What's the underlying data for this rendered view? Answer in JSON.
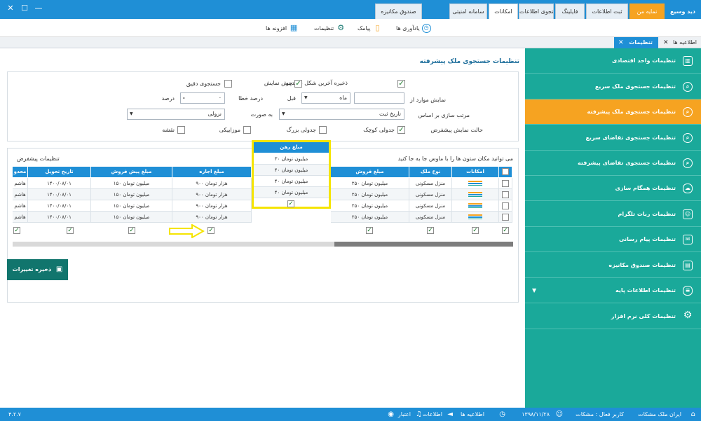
{
  "window": {
    "minimize": "—",
    "maximize": "☐",
    "close": "✕"
  },
  "top_tabs": [
    {
      "label": "دید وسیع",
      "style": "plain"
    },
    {
      "label": "نمایه من",
      "style": "orange"
    },
    {
      "label": "ثبت اطلاعات",
      "style": "normal"
    },
    {
      "label": "فایلینگ",
      "style": "normal"
    },
    {
      "label": "جستجوی اطلاعات",
      "style": "normal"
    },
    {
      "label": "امکانات",
      "style": "active"
    },
    {
      "label": "سامانه امنیتی",
      "style": "normal"
    },
    {
      "label": "صندوق مکانیزه",
      "style": "normal"
    }
  ],
  "ribbon": [
    {
      "label": "یادآوری ها",
      "icon": "clock-icon"
    },
    {
      "label": "پیامک",
      "icon": "sms-icon"
    },
    {
      "label": "تنظیمات",
      "icon": "gear-icon"
    },
    {
      "label": "افزونه ها",
      "icon": "puzzle-icon"
    }
  ],
  "doc_tabs": [
    {
      "label": "تنظیمات",
      "active": true
    },
    {
      "label": "اطلاعیه ها",
      "active": false
    }
  ],
  "page_title": "تنظیمات جستجوی ملک پیشرفته",
  "options": {
    "save_last_search": "ذخیره آخرین شکل جستجو",
    "preview": "پیش نمایش",
    "exact_search": "جستجوی دقیق",
    "show_items_from": "نمایش موارد از",
    "month_value": "ماه",
    "before": "قبل",
    "error_percent": "درصد خطا",
    "error_value": "۰",
    "percent": "درصد",
    "sort_by": "مرتب سازی بر اساس",
    "sort_value": "تاریخ ثبت",
    "as": "به صورت",
    "order_value": "نزولی",
    "default_view": "حالت نمایش پیشفرض",
    "view_small_table": "جدولی کوچک",
    "view_big_table": "جدولی بزرگ",
    "view_mosaic": "موزاییکی",
    "view_map": "نقشه"
  },
  "grid": {
    "hint": "می توانید مکان ستون ها را با ماوس جا به جا کنید",
    "default_settings": "تنظیمات پیشفرض",
    "headers": [
      "امکانات",
      "نوع ملک",
      "مبلغ فروش",
      "مبلغ اجاره",
      "مبلغ پیش فروش",
      "تاریخ تحویل",
      "محدو"
    ],
    "rows": [
      {
        "type": "منزل مسکونی",
        "sale": "۲۵۰ میلیون تومان",
        "rent": "۹۰۰ هزار تومان",
        "presale": "۱۵۰ میلیون تومان",
        "delivery": "۱۴۰۰/۰۸/۰۱",
        "area": "هاشم"
      },
      {
        "type": "منزل مسکونی",
        "sale": "۲۵۰ میلیون تومان",
        "rent": "۹۰۰ هزار تومان",
        "presale": "۱۵۰ میلیون تومان",
        "delivery": "۱۴۰۰/۰۸/۰۱",
        "area": "هاشم"
      },
      {
        "type": "منزل مسکونی",
        "sale": "۲۵۰ میلیون تومان",
        "rent": "۹۰۰ هزار تومان",
        "presale": "۱۵۰ میلیون تومان",
        "delivery": "۱۴۰۰/۰۸/۰۱",
        "area": "هاشم"
      },
      {
        "type": "منزل مسکونی",
        "sale": "۲۵۰ میلیون تومان",
        "rent": "۹۰۰ هزار تومان",
        "presale": "۱۵۰ میلیون تومان",
        "delivery": "۱۴۰۰/۰۸/۰۱",
        "area": "هاشم"
      }
    ]
  },
  "popup": {
    "header": "مبلغ رهن",
    "values": [
      "۳۰ میلیون تومان",
      "۴۰ میلیون تومان",
      "۴۰ میلیون تومان",
      "۴۰ میلیون تومان"
    ]
  },
  "save_button": "ذخیره تغییرات",
  "sidebar": [
    {
      "label": "تنظیمات واحد اقتصادی",
      "icon": "building-icon"
    },
    {
      "label": "تنظیمات جستجوی ملک سریع",
      "icon": "search-icon"
    },
    {
      "label": "تنظیمات جستجوی ملک پیشرفته",
      "icon": "search-icon",
      "active": true
    },
    {
      "label": "تنظیمات جستجوی تقاضای سریع",
      "icon": "search-icon"
    },
    {
      "label": "تنظیمات جستجوی تقاضای پیشرفته",
      "icon": "search-icon"
    },
    {
      "label": "تنظیمات همگام سازی",
      "icon": "cloud-sync-icon"
    },
    {
      "label": "تنظیمات ربات تلگرام",
      "icon": "robot-icon"
    },
    {
      "label": "تنظیمات پیام رسانی",
      "icon": "message-icon"
    },
    {
      "label": "تنظیمات صندوق مکانیزه",
      "icon": "register-icon"
    },
    {
      "label": "تنظیمات اطلاعات پایه",
      "icon": "database-icon",
      "expand": "▼"
    },
    {
      "label": "تنظیمات کلی نرم افزار",
      "icon": "gear-icon"
    }
  ],
  "status": {
    "company": "ایران ملک مشکات",
    "user": "کاربر فعال : مشکات",
    "date": "۱۳۹۸/۱۱/۲۸",
    "announcements": "اطلاعیه ها",
    "news": "اطلاعات",
    "credit": "اعتبار",
    "version": "۴.۲.۷"
  },
  "colors": {
    "primary": "#1f8fd6",
    "sidebar": "#1aa99a",
    "active": "#f6a321",
    "save": "#11756d",
    "highlight": "#f5e400"
  }
}
